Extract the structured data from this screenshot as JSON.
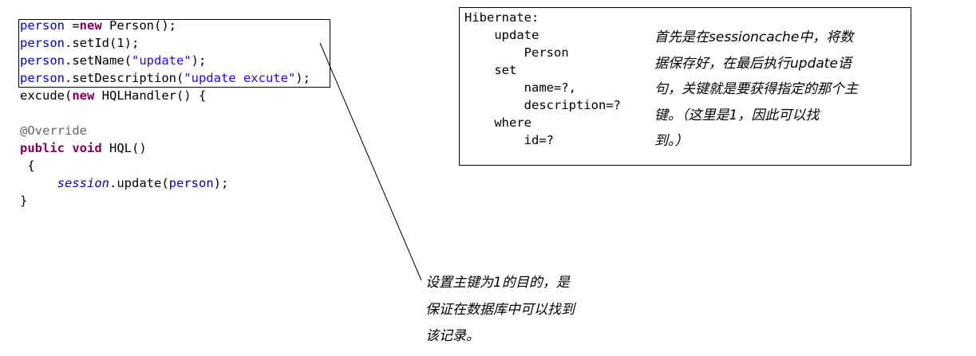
{
  "code_lines": {
    "l1": {
      "v": "person",
      "p1": " =",
      "k": "new",
      "p2": " Person();"
    },
    "l2": {
      "v": "person",
      "p": ".setId(1);"
    },
    "l3": {
      "v": "person",
      "p1": ".setName(",
      "s": "\"update\"",
      "p2": ");"
    },
    "l4": {
      "v": "person",
      "p1": ".setDescription(",
      "s": "\"update excute\"",
      "p2": ");"
    },
    "l5": {
      "p1": "excude(",
      "k": "new",
      "p2": " HQLHandler() {"
    },
    "l7": {
      "a": "@Override"
    },
    "l8": {
      "k1": "public",
      "k2": "void",
      "p": " HQL()"
    },
    "l9": {
      "p": " {"
    },
    "l10": {
      "indent": "     ",
      "v1": "session",
      "p1": ".update(",
      "v2": "person",
      "p2": ");"
    },
    "l11": {
      "p": "}"
    }
  },
  "hibernate": {
    "lines": [
      "Hibernate:",
      "    update",
      "        Person",
      "    set",
      "        name=?,",
      "        description=?",
      "    where",
      "        id=?"
    ]
  },
  "notes": {
    "right": [
      "首先是在sessioncache中，将数",
      "据保存好，在最后执行update语",
      "句，关键就是要获得指定的那个主",
      "键。（这里是1，因此可以找",
      "到。）"
    ],
    "bottom": [
      "设置主键为1的目的，是",
      "保证在数据库中可以找到",
      "该记录。"
    ]
  }
}
